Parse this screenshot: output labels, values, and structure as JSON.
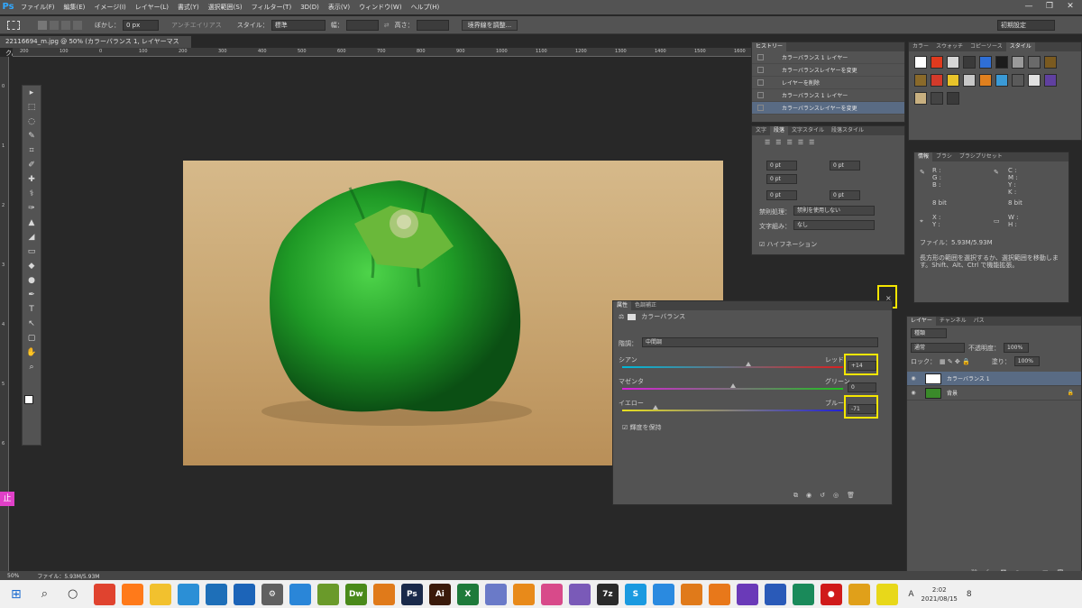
{
  "app": {
    "logo": "Ps"
  },
  "menu": [
    "ファイル(F)",
    "編集(E)",
    "イメージ(I)",
    "レイヤー(L)",
    "書式(Y)",
    "選択範囲(S)",
    "フィルター(T)",
    "3D(D)",
    "表示(V)",
    "ウィンドウ(W)",
    "ヘルプ(H)"
  ],
  "window_controls": {
    "minimize": "—",
    "maximize": "❐",
    "close": "✕"
  },
  "options": {
    "feather_label": "ぼかし：",
    "feather_value": "0 px",
    "antialias_label": "アンチエイリアス",
    "style_label": "スタイル：",
    "style_value": "標準",
    "width_label": "幅：",
    "height_label": "高さ：",
    "refine_button": "境界線を調整...",
    "workspace": "初期設定"
  },
  "document": {
    "tab": "22116694_m.jpg @ 50% (カラーバランス 1, レイヤーマスク/8) *",
    "close": "×"
  },
  "ruler_h": [
    "200",
    "100",
    "0",
    "100",
    "200",
    "300",
    "400",
    "500",
    "600",
    "700",
    "800",
    "900",
    "1000",
    "1100",
    "1200",
    "1300",
    "1400",
    "1500",
    "1600"
  ],
  "ruler_v": [
    "0",
    "1",
    "2",
    "3",
    "4",
    "5",
    "6",
    "7"
  ],
  "tools": [
    "▸",
    "⬚",
    "◌",
    "✎",
    "⌗",
    "✐",
    "✚",
    "⚕",
    "✑",
    "▲",
    "◢",
    "▭",
    "◆",
    "●",
    "✒",
    "T",
    "↖",
    "▢",
    "✋",
    "⌕"
  ],
  "history": {
    "tab": "ヒストリー",
    "items": [
      "カラーバランス 1 レイヤー",
      "カラーバランスレイヤーを変更",
      "レイヤーを削除",
      "カラーバランス 1 レイヤー",
      "カラーバランスレイヤーを変更"
    ]
  },
  "paragraph": {
    "tabs": [
      "文字",
      "段落",
      "文字スタイル",
      "段落スタイル"
    ],
    "indent_values": [
      "0 pt",
      "0 pt",
      "0 pt",
      "0 pt",
      "0 pt"
    ],
    "kinsoku_label": "禁則処理：",
    "kinsoku_value": "禁則を使用しない",
    "mojigumi_label": "文字組み：",
    "mojigumi_value": "なし",
    "hyphenation": "ハイフネーション"
  },
  "swatches_panel": {
    "tabs": [
      "カラー",
      "スウォッチ",
      "コピーソース",
      "スタイル"
    ],
    "colors": [
      "#ffffff",
      "#e03a1e",
      "#d6d6d6",
      "#3a3a3a",
      "#2f6fd6",
      "#1c1c1c",
      "#9a9a9a",
      "#6a6a6a",
      "#7a5a20",
      "#8a6a2a",
      "#d23a2a",
      "#e8c42a",
      "#c8c8c8",
      "#e0801e",
      "#3a9ad6",
      "#5a5a5a",
      "#e0e0e0",
      "#6040a0",
      "#c8b080",
      "#444444",
      "#3a3a3a"
    ]
  },
  "info": {
    "tabs": [
      "情報",
      "ブラシ",
      "ブラシプリセット"
    ],
    "rgb": [
      "R :",
      "G :",
      "B :"
    ],
    "cmyk": [
      "C :",
      "M :",
      "Y :",
      "K :"
    ],
    "bit_left": "8 bit",
    "bit_right": "8 bit",
    "xy": [
      "X :",
      "Y :"
    ],
    "wh": [
      "W :",
      "H :"
    ],
    "file": "ファイル：5.93M/5.93M",
    "hint": "長方形の範囲を選択するか、選択範囲を移動します。Shift、Alt、Ctrl で機能拡張。"
  },
  "properties": {
    "tabs": [
      "属性",
      "色調補正"
    ],
    "title": "カラーバランス",
    "tone_label": "階調：",
    "tone_value": "中間調",
    "sliders": [
      {
        "left": "シアン",
        "right": "レッド",
        "value": "+14",
        "position": 0.57
      },
      {
        "left": "マゼンタ",
        "right": "グリーン",
        "value": "0",
        "position": 0.5
      },
      {
        "left": "イエロー",
        "right": "ブルー",
        "value": "-71",
        "position": 0.15
      }
    ],
    "preserve": "輝度を保持"
  },
  "layers": {
    "tabs": [
      "レイヤー",
      "チャンネル",
      "パス"
    ],
    "kind": "種類",
    "blend": "通常",
    "opacity_label": "不透明度：",
    "opacity": "100%",
    "lock_label": "ロック：",
    "fill_label": "塗り：",
    "fill": "100%",
    "items": [
      {
        "name": "カラーバランス 1",
        "selected": true
      },
      {
        "name": "背景",
        "selected": false
      }
    ]
  },
  "status": {
    "zoom": "50%",
    "file": "ファイル：5.93M/5.93M"
  },
  "ime_badge": "止",
  "taskbar": {
    "icons": [
      {
        "name": "chrome",
        "label": "",
        "color": "#e0432f"
      },
      {
        "name": "firefox",
        "label": "",
        "color": "#ff7a1a"
      },
      {
        "name": "explorer",
        "label": "",
        "color": "#f2c12e"
      },
      {
        "name": "app-blue",
        "label": "",
        "color": "#2b8fd6"
      },
      {
        "name": "photos",
        "label": "",
        "color": "#1e6fb8"
      },
      {
        "name": "outlook",
        "label": "",
        "color": "#1c64b8"
      },
      {
        "name": "settings",
        "label": "⚙",
        "color": "#606060"
      },
      {
        "name": "remote",
        "label": "",
        "color": "#2a86d8"
      },
      {
        "name": "fireworks",
        "label": "",
        "color": "#6a9a2a"
      },
      {
        "name": "dreamweaver",
        "label": "Dw",
        "color": "#4a8a1a"
      },
      {
        "name": "sublime",
        "label": "",
        "color": "#e07a1a"
      },
      {
        "name": "photoshop",
        "label": "Ps",
        "color": "#1a2a4a"
      },
      {
        "name": "illustrator",
        "label": "Ai",
        "color": "#3a1a0a"
      },
      {
        "name": "excel",
        "label": "X",
        "color": "#1e7a3a"
      },
      {
        "name": "app-pen",
        "label": "",
        "color": "#6a7ac8"
      },
      {
        "name": "butterfly",
        "label": "",
        "color": "#e88a1a"
      },
      {
        "name": "paint",
        "label": "",
        "color": "#d84a8a"
      },
      {
        "name": "brush",
        "label": "",
        "color": "#7a5ab8"
      },
      {
        "name": "7zip",
        "label": "7z",
        "color": "#2a2a2a"
      },
      {
        "name": "skype",
        "label": "S",
        "color": "#1a9ae0"
      },
      {
        "name": "zoom",
        "label": "",
        "color": "#2a8ae0"
      },
      {
        "name": "player",
        "label": "",
        "color": "#e07a1a"
      },
      {
        "name": "vlc",
        "label": "",
        "color": "#e8781a"
      },
      {
        "name": "app-purple",
        "label": "",
        "color": "#6a3ab8"
      },
      {
        "name": "music",
        "label": "",
        "color": "#2a5ab8"
      },
      {
        "name": "app-green",
        "label": "",
        "color": "#1a8a5a"
      },
      {
        "name": "record",
        "label": "●",
        "color": "#d01a1a"
      },
      {
        "name": "mascot",
        "label": "",
        "color": "#e0a01a"
      },
      {
        "name": "notes",
        "label": "",
        "color": "#e8d81a"
      }
    ],
    "ime": "A",
    "time": "2:02",
    "date": "2021/08/15",
    "notifications": "8"
  }
}
